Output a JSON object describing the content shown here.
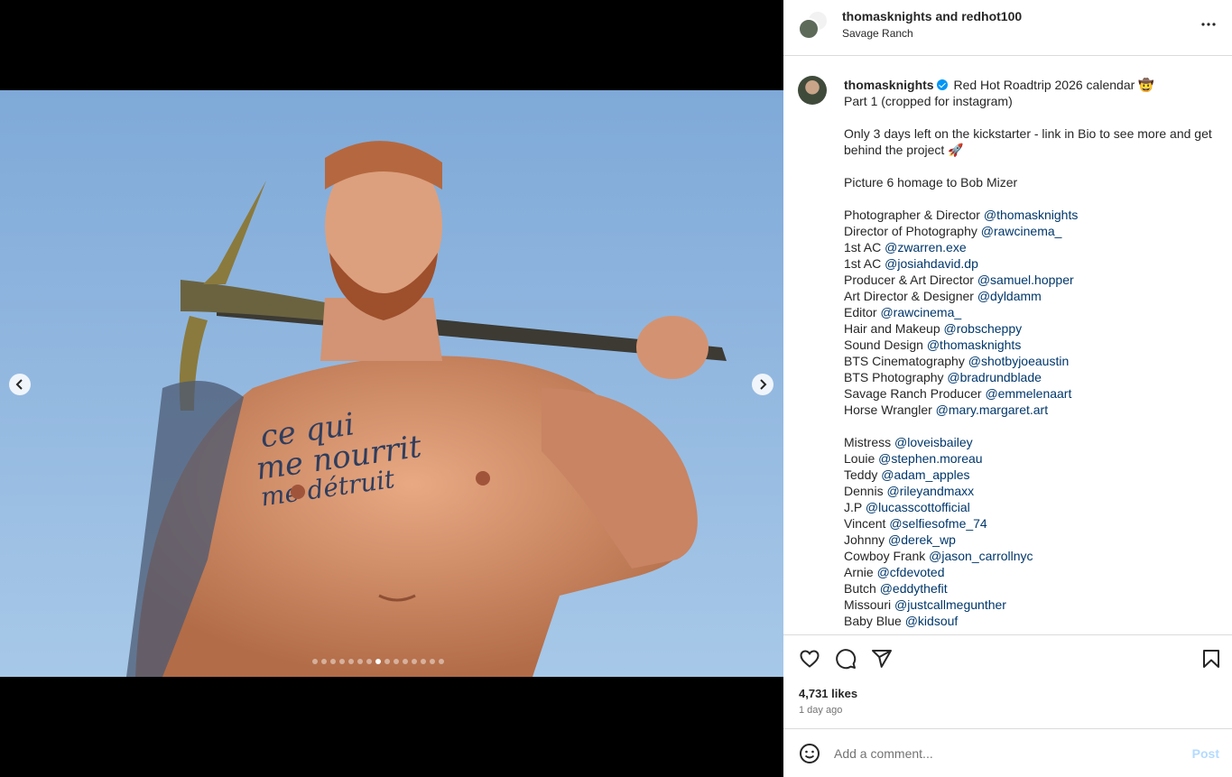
{
  "header": {
    "title": "thomasknights and redhot100",
    "location": "Savage Ranch"
  },
  "caption": {
    "username": "thomasknights",
    "lines": [
      "Red Hot Roadtrip 2026 calendar 🤠",
      "Part 1 (cropped for instagram)",
      "",
      "Only 3 days left on the kickstarter - link in Bio to see more and get",
      "behind the project 🚀",
      "",
      "Picture 6 homage to Bob Mizer",
      ""
    ],
    "credits": [
      {
        "role": "Photographer & Director",
        "handle": "@thomasknights"
      },
      {
        "role": "Director of Photography",
        "handle": "@rawcinema_"
      },
      {
        "role": "1st AC",
        "handle": "@zwarren.exe"
      },
      {
        "role": "1st AC",
        "handle": "@josiahdavid.dp"
      },
      {
        "role": "Producer & Art Director",
        "handle": "@samuel.hopper"
      },
      {
        "role": "Art Director & Designer",
        "handle": "@dyldamm"
      },
      {
        "role": "Editor",
        "handle": "@rawcinema_"
      },
      {
        "role": "Hair and Makeup",
        "handle": "@robscheppy"
      },
      {
        "role": "Sound Design",
        "handle": "@thomasknights"
      },
      {
        "role": "BTS Cinematography",
        "handle": "@shotbyjoeaustin"
      },
      {
        "role": "BTS Photography",
        "handle": "@bradrundblade"
      },
      {
        "role": "Savage Ranch Producer",
        "handle": "@emmelenaart"
      },
      {
        "role": "Horse Wrangler",
        "handle": "@mary.margaret.art"
      }
    ],
    "cast": [
      {
        "role": "Mistress",
        "handle": "@loveisbailey"
      },
      {
        "role": "Louie",
        "handle": "@stephen.moreau"
      },
      {
        "role": "Teddy",
        "handle": "@adam_apples"
      },
      {
        "role": "Dennis",
        "handle": "@rileyandmaxx"
      },
      {
        "role": "J.P",
        "handle": "@lucasscottofficial"
      },
      {
        "role": "Vincent",
        "handle": "@selfiesofme_74"
      },
      {
        "role": "Johnny",
        "handle": "@derek_wp"
      },
      {
        "role": "Cowboy Frank",
        "handle": "@jason_carrollnyc"
      },
      {
        "role": "Arnie",
        "handle": "@cfdevoted"
      },
      {
        "role": "Butch",
        "handle": "@eddythefit"
      },
      {
        "role": "Missouri",
        "handle": "@justcallmegunther"
      },
      {
        "role": "Baby Blue",
        "handle": "@kidsouf"
      }
    ]
  },
  "stats": {
    "likes": "4,731 likes",
    "time_ago": "1 day ago"
  },
  "comment": {
    "placeholder": "Add a comment...",
    "post_label": "Post"
  },
  "carousel": {
    "total": 15,
    "active_index": 7
  },
  "colors": {
    "mention": "#00376b",
    "verified": "#0095f6",
    "post_disabled": "#b3dbff",
    "sky": "#8fb7df"
  },
  "icons": [
    "more-icon",
    "verified-icon",
    "heart-icon",
    "comment-icon",
    "share-icon",
    "bookmark-icon",
    "emoji-icon",
    "chevron-left-icon",
    "chevron-right-icon"
  ]
}
